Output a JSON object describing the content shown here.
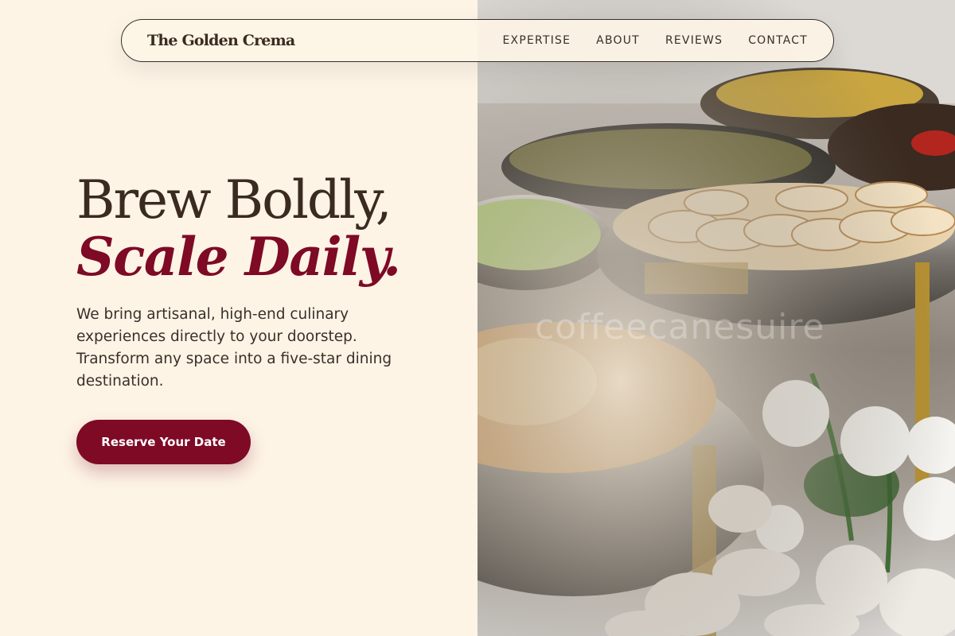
{
  "brand": "The Golden Crema",
  "nav": {
    "links": [
      "EXPERTISE",
      "ABOUT",
      "REVIEWS",
      "CONTACT"
    ]
  },
  "hero": {
    "headline_line1": "Brew Boldly,",
    "headline_line2": "Scale Daily.",
    "description": "We bring artisanal, high-end culinary experiences directly to your doorstep. Transform any space into a five-star dining destination.",
    "cta_label": "Reserve Your Date"
  },
  "image": {
    "watermark": "coffeecanesuire"
  },
  "colors": {
    "background": "#fdf4e6",
    "accent": "#7e0a25",
    "text": "#3a2a1f"
  }
}
